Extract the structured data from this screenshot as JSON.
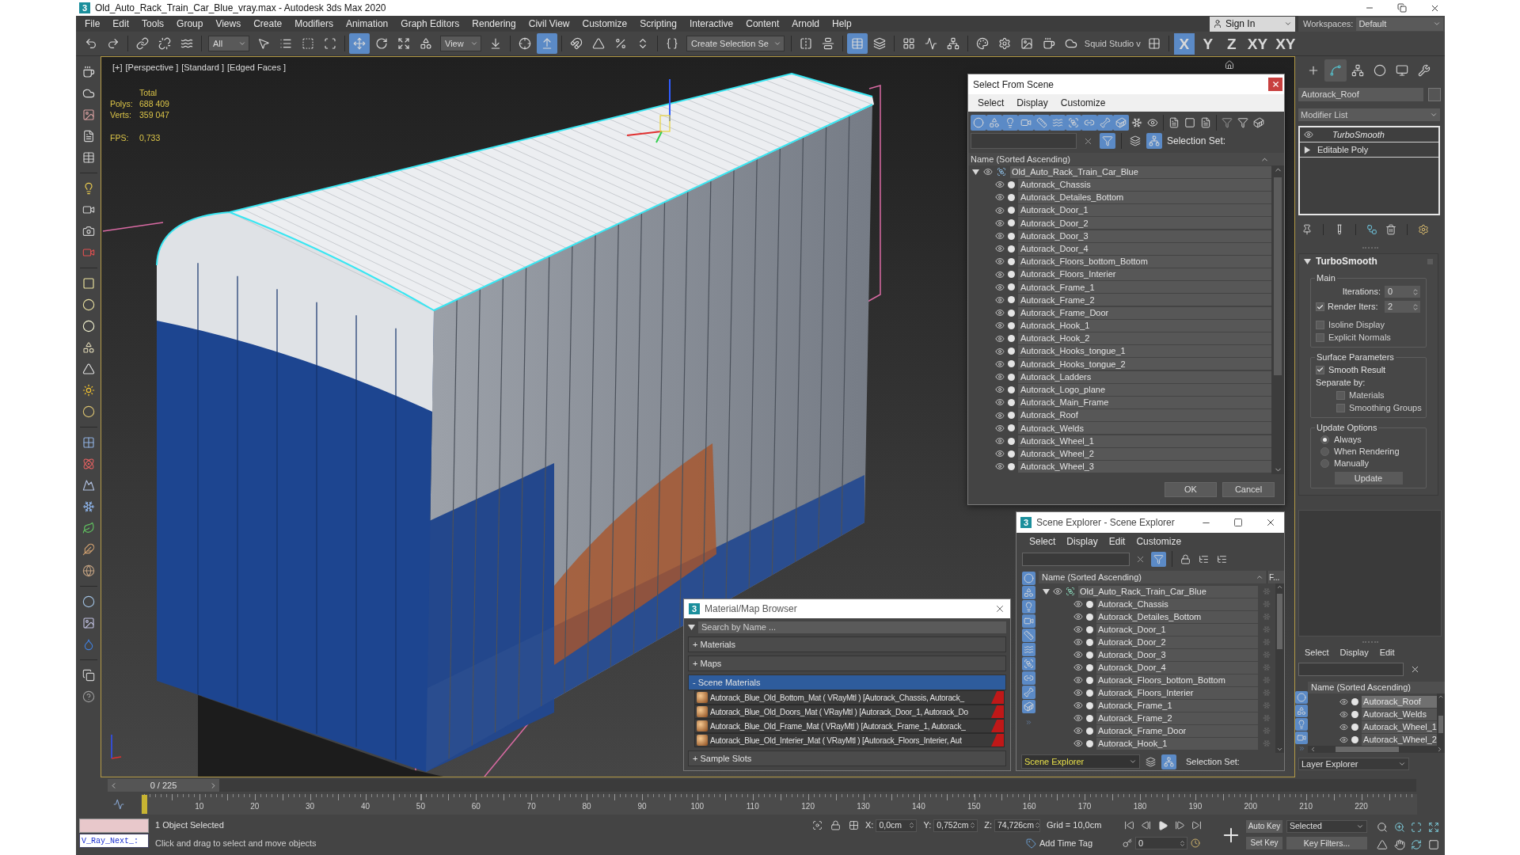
{
  "window": {
    "logo": "3",
    "title": "Old_Auto_Rack_Train_Car_Blue_vray.max - Autodesk 3ds Max 2020"
  },
  "menu": {
    "items": [
      "File",
      "Edit",
      "Tools",
      "Group",
      "Views",
      "Create",
      "Modifiers",
      "Animation",
      "Graph Editors",
      "Rendering",
      "Civil View",
      "Customize",
      "Scripting",
      "Interactive",
      "Content",
      "Arnold",
      "Help"
    ],
    "sign_in": "Sign In",
    "workspaces_label": "Workspaces:",
    "workspace": "Default"
  },
  "toolbar": {
    "groups": [
      [
        {
          "kind": "undo",
          "selected": false
        },
        {
          "kind": "redo",
          "selected": false
        }
      ],
      [
        {
          "kind": "link",
          "selected": false
        },
        {
          "kind": "unlink",
          "selected": false
        },
        {
          "kind": "bind",
          "selected": false
        }
      ],
      [
        {
          "kind": "dropdown",
          "value": "All"
        },
        {
          "kind": "select",
          "selected": false
        },
        {
          "kind": "select_by_name",
          "selected": false
        },
        {
          "kind": "region",
          "selected": false
        },
        {
          "kind": "crossing",
          "selected": false
        }
      ],
      [
        {
          "kind": "move",
          "selected": true
        },
        {
          "kind": "rotate",
          "selected": false
        },
        {
          "kind": "scale",
          "selected": false
        },
        {
          "kind": "place",
          "selected": false
        },
        {
          "kind": "dropdown",
          "value": "View"
        },
        {
          "kind": "pivot",
          "selected": false
        }
      ],
      [
        {
          "kind": "manipulate",
          "selected": false
        },
        {
          "kind": "shortcut_override",
          "selected": true
        }
      ],
      [
        {
          "kind": "snap",
          "selected": false
        },
        {
          "kind": "angle_snap",
          "selected": false
        },
        {
          "kind": "percent_snap",
          "selected": false
        },
        {
          "kind": "spinner_snap",
          "selected": false
        }
      ],
      [
        {
          "kind": "named_sets",
          "selected": false
        },
        {
          "kind": "dropdown",
          "value": "Create Selection Se"
        }
      ],
      [
        {
          "kind": "mirror",
          "selected": false
        },
        {
          "kind": "align",
          "selected": false
        }
      ],
      [
        {
          "kind": "scene_explorer",
          "selected": true
        },
        {
          "kind": "layer_explorer",
          "selected": false
        }
      ],
      [
        {
          "kind": "toolbox",
          "selected": false
        },
        {
          "kind": "curve_editor",
          "selected": false
        },
        {
          "kind": "schematic",
          "selected": false
        }
      ],
      [
        {
          "kind": "material_editor",
          "selected": false
        },
        {
          "kind": "render_setup",
          "selected": false
        },
        {
          "kind": "frame_window",
          "selected": false
        },
        {
          "kind": "render",
          "selected": false
        },
        {
          "kind": "cloud_render",
          "selected": false
        },
        {
          "kind": "label",
          "text": "Squid Studio v"
        },
        {
          "kind": "grid",
          "selected": false
        }
      ],
      [
        {
          "kind": "axis",
          "label": "X",
          "selected": true
        },
        {
          "kind": "axis",
          "label": "Y",
          "selected": false
        },
        {
          "kind": "axis",
          "label": "Z",
          "selected": false
        },
        {
          "kind": "axis",
          "label": "XY",
          "selected": false
        },
        {
          "kind": "axis",
          "label": "XY",
          "selected": false
        }
      ]
    ]
  },
  "viewport": {
    "labels": [
      "[+]",
      "[Perspective ]",
      "[Standard ]",
      "[Edged Faces ]"
    ],
    "stats": {
      "title": "Total",
      "rows": [
        {
          "label": "Polys:",
          "value": "688 409"
        },
        {
          "label": "Verts:",
          "value": "359 047"
        }
      ],
      "fps_label": "FPS:",
      "fps": "0,733"
    }
  },
  "select_from_scene": {
    "title": "Select From Scene",
    "menus": [
      "Select",
      "Display",
      "Customize"
    ],
    "filters": [
      {
        "kind": "geometry",
        "selected": true
      },
      {
        "kind": "shapes",
        "selected": true
      },
      {
        "kind": "lights",
        "selected": true
      },
      {
        "kind": "cameras",
        "selected": true
      },
      {
        "kind": "helpers",
        "selected": true
      },
      {
        "kind": "spacewarps",
        "selected": true
      },
      {
        "kind": "groups",
        "selected": true
      },
      {
        "kind": "xrefs",
        "selected": true
      },
      {
        "kind": "bones",
        "selected": true
      },
      {
        "kind": "containers",
        "selected": true
      },
      {
        "kind": "frozen",
        "selected": false
      },
      {
        "kind": "hidden",
        "selected": false
      }
    ],
    "toggles": [
      {
        "kind": "filter",
        "selected": true
      },
      {
        "kind": "layers",
        "selected": false
      },
      {
        "kind": "hierarchy",
        "selected": true
      }
    ],
    "selection_set_label": "Selection Set:",
    "column": "Name (Sorted Ascending)",
    "tree": {
      "name": "Old_Auto_Rack_Train_Car_Blue",
      "expanded": true,
      "children": [
        {
          "name": "Autorack_Chassis"
        },
        {
          "name": "Autorack_Detailes_Bottom"
        },
        {
          "name": "Autorack_Door_1"
        },
        {
          "name": "Autorack_Door_2"
        },
        {
          "name": "Autorack_Door_3"
        },
        {
          "name": "Autorack_Door_4"
        },
        {
          "name": "Autorack_Floors_bottom_Bottom"
        },
        {
          "name": "Autorack_Floors_Interier"
        },
        {
          "name": "Autorack_Frame_1"
        },
        {
          "name": "Autorack_Frame_2"
        },
        {
          "name": "Autorack_Frame_Door"
        },
        {
          "name": "Autorack_Hook_1"
        },
        {
          "name": "Autorack_Hook_2"
        },
        {
          "name": "Autorack_Hooks_tongue_1"
        },
        {
          "name": "Autorack_Hooks_tongue_2"
        },
        {
          "name": "Autorack_Ladders"
        },
        {
          "name": "Autorack_Logo_plane"
        },
        {
          "name": "Autorack_Main_Frame"
        },
        {
          "name": "Autorack_Roof"
        },
        {
          "name": "Autorack_Welds"
        },
        {
          "name": "Autorack_Wheel_1"
        },
        {
          "name": "Autorack_Wheel_2"
        },
        {
          "name": "Autorack_Wheel_3"
        }
      ]
    },
    "buttons": [
      "OK",
      "Cancel"
    ]
  },
  "command_panel": {
    "tabs": [
      {
        "kind": "create",
        "selected": false
      },
      {
        "kind": "modify",
        "selected": true
      },
      {
        "kind": "hierarchy",
        "selected": false
      },
      {
        "kind": "motion",
        "selected": false
      },
      {
        "kind": "display",
        "selected": false
      },
      {
        "kind": "utilities",
        "selected": false
      }
    ],
    "object_name": "Autorack_Roof",
    "modifier_list": "Modifier List",
    "stack": [
      {
        "kind": "modifier",
        "name": "TurboSmooth"
      },
      {
        "kind": "base",
        "name": "Editable Poly"
      }
    ],
    "rollout": {
      "title": "TurboSmooth",
      "groups": [
        {
          "title": "Main",
          "controls": [
            {
              "kind": "spinner",
              "label": "Iterations:",
              "value": "0"
            },
            {
              "kind": "check_spinner",
              "label": "Render Iters:",
              "value": "2",
              "checked": true
            },
            {
              "kind": "checkbox",
              "label": "Isoline Display",
              "checked": false
            },
            {
              "kind": "checkbox",
              "label": "Explicit Normals",
              "checked": false
            }
          ]
        },
        {
          "title": "Surface Parameters",
          "controls": [
            {
              "kind": "checkbox",
              "label": "Smooth Result",
              "checked": true
            },
            {
              "kind": "text",
              "label": "Separate by:",
              "children": [
                {
                  "kind": "checkbox",
                  "label": "Materials",
                  "checked": false
                },
                {
                  "kind": "checkbox",
                  "label": "Smoothing Groups",
                  "checked": false
                }
              ]
            }
          ]
        },
        {
          "title": "Update Options",
          "controls": [
            {
              "kind": "radio",
              "label": "Always",
              "selected": true
            },
            {
              "kind": "radio",
              "label": "When Rendering",
              "selected": false
            },
            {
              "kind": "radio",
              "label": "Manually",
              "selected": false
            },
            {
              "kind": "button",
              "label": "Update"
            }
          ]
        }
      ]
    }
  },
  "layer_explorer": {
    "menus": [
      "Select",
      "Display",
      "Edit"
    ],
    "filters": [
      {
        "kind": "geometry",
        "selected": true
      },
      {
        "kind": "shapes",
        "selected": true
      },
      {
        "kind": "lights",
        "selected": true
      },
      {
        "kind": "cameras",
        "selected": true
      }
    ],
    "column": "Name (Sorted Ascending)",
    "rows": [
      {
        "name": "Autorack_Roof",
        "selected": true
      },
      {
        "name": "Autorack_Welds",
        "selected": false
      },
      {
        "name": "Autorack_Wheel_1",
        "selected": false
      },
      {
        "name": "Autorack_Wheel_2",
        "selected": false
      }
    ],
    "mode": "Layer Explorer"
  },
  "material_browser": {
    "logo": "3",
    "title": "Material/Map Browser",
    "search_placeholder": "Search by Name ...",
    "sections": [
      {
        "sign": "+",
        "label": "Materials",
        "expanded": false
      },
      {
        "sign": "+",
        "label": "Maps",
        "expanded": false
      },
      {
        "sign": "-",
        "label": "Scene Materials",
        "expanded": true,
        "items": [
          "Autorack_Blue_Old_Bottom_Mat ( VRayMtl ) [Autorack_Chassis, Autorack_",
          "Autorack_Blue_Old_Doors_Mat ( VRayMtl ) [Autorack_Door_1, Autorack_Do",
          "Autorack_Blue_Old_Frame_Mat ( VRayMtl ) [Autorack_Frame_1, Autorack_",
          "Autorack_Blue_Old_Interier_Mat ( VRayMtl ) [Autorack_Floors_Interier, Aut"
        ]
      },
      {
        "sign": "+",
        "label": "Sample Slots",
        "expanded": false
      }
    ]
  },
  "scene_explorer": {
    "logo": "3",
    "title": "Scene Explorer - Scene Explorer",
    "menus": [
      "Select",
      "Display",
      "Edit",
      "Customize"
    ],
    "toggles": [
      {
        "kind": "filter",
        "selected": true
      },
      {
        "kind": "lock",
        "selected": false
      },
      {
        "kind": "tree",
        "selected": false
      },
      {
        "kind": "tree",
        "selected": false
      }
    ],
    "filters": [
      {
        "kind": "geometry",
        "selected": true
      },
      {
        "kind": "shapes",
        "selected": true
      },
      {
        "kind": "lights",
        "selected": true
      },
      {
        "kind": "cameras",
        "selected": true
      },
      {
        "kind": "helpers",
        "selected": true
      },
      {
        "kind": "spacewarps",
        "selected": true
      },
      {
        "kind": "groups",
        "selected": true
      },
      {
        "kind": "xrefs",
        "selected": true
      },
      {
        "kind": "bones",
        "selected": true
      },
      {
        "kind": "containers",
        "selected": true
      }
    ],
    "columns": [
      "Name (Sorted Ascending)",
      "F..."
    ],
    "tree": {
      "name": "Old_Auto_Rack_Train_Car_Blue",
      "expanded": true,
      "children": [
        {
          "name": "Autorack_Chassis"
        },
        {
          "name": "Autorack_Detailes_Bottom"
        },
        {
          "name": "Autorack_Door_1"
        },
        {
          "name": "Autorack_Door_2"
        },
        {
          "name": "Autorack_Door_3"
        },
        {
          "name": "Autorack_Door_4"
        },
        {
          "name": "Autorack_Floors_bottom_Bottom"
        },
        {
          "name": "Autorack_Floors_Interier"
        },
        {
          "name": "Autorack_Frame_1"
        },
        {
          "name": "Autorack_Frame_2"
        },
        {
          "name": "Autorack_Frame_Door"
        },
        {
          "name": "Autorack_Hook_1"
        }
      ]
    },
    "mode": "Scene Explorer",
    "footer_toggles": [
      {
        "kind": "layers",
        "selected": false
      },
      {
        "kind": "hierarchy",
        "selected": true
      }
    ],
    "selection_set_label": "Selection Set:"
  },
  "time_slider": {
    "position": "0 / 225",
    "level": 0
  },
  "track_bar": {
    "ticks": [
      "10",
      "20",
      "30",
      "40",
      "50",
      "60",
      "70",
      "80",
      "90",
      "100",
      "110",
      "120",
      "130",
      "140",
      "150",
      "160",
      "170",
      "180",
      "190",
      "200",
      "210",
      "220"
    ]
  },
  "status_bar": {
    "listener": "V_Ray_Next_:",
    "selection": "1 Object Selected",
    "prompt": "Click and drag to select and move objects",
    "coordinates": [
      {
        "axis": "X:",
        "value": "0,0cm"
      },
      {
        "axis": "Y:",
        "value": "0,752cm"
      },
      {
        "axis": "Z:",
        "value": "74,726cm"
      }
    ],
    "grid": "Grid = 10,0cm",
    "time_tag": "Add Time Tag",
    "frame": "0",
    "auto_key": "Auto Key",
    "key_mode": "Selected",
    "set_key": "Set Key",
    "key_filters": "Key Filters..."
  }
}
